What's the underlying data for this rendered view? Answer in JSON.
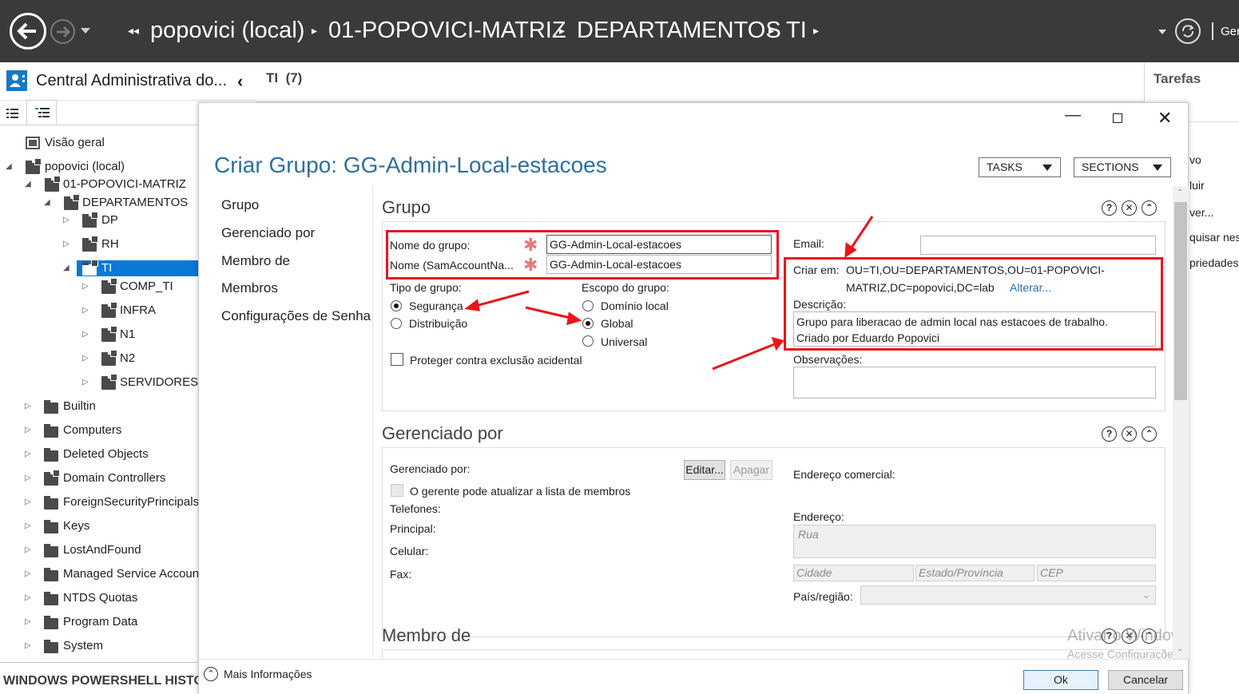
{
  "topbar": {
    "breadcrumb": [
      "popovici (local)",
      "01-POPOVICI-MATRIZ",
      "DEPARTAMENTOS",
      "TI"
    ],
    "right_text": "Ger"
  },
  "left_pane": {
    "title": "Central Administrativa do...",
    "tree": {
      "overview": "Visão geral",
      "domain": "popovici (local)",
      "matriz": "01-POPOVICI-MATRIZ",
      "departamentos": "DEPARTAMENTOS",
      "dp": "DP",
      "rh": "RH",
      "ti": "TI",
      "comp_ti": "COMP_TI",
      "infra": "INFRA",
      "n1": "N1",
      "n2": "N2",
      "servidores": "SERVIDORES",
      "builtin": "Builtin",
      "computers": "Computers",
      "deleted": "Deleted Objects",
      "dcs": "Domain Controllers",
      "fsp": "ForeignSecurityPrincipals",
      "keys": "Keys",
      "lostfound": "LostAndFound",
      "msa": "Managed Service Accounts",
      "ntds": "NTDS Quotas",
      "progdata": "Program Data",
      "system": "System"
    },
    "powershell": "WINDOWS POWERSHELL HISTORY"
  },
  "main_header": {
    "title": "TI",
    "count": "(7)"
  },
  "task_pane": {
    "title": "Tarefas",
    "items": [
      "vo",
      "luir",
      "ver...",
      "quisar nes",
      "priedades"
    ]
  },
  "dialog": {
    "title": "Criar Grupo: GG-Admin-Local-estacoes",
    "tasks_label": "TASKS",
    "sections_label": "SECTIONS",
    "nav": [
      "Grupo",
      "Gerenciado por",
      "Membro de",
      "Membros",
      "Configurações de Senha"
    ],
    "grupo": {
      "section_title": "Grupo",
      "name_label": "Nome do grupo:",
      "name_value": "GG-Admin-Local-estacoes",
      "sam_label": "Nome (SamAccountNa...",
      "sam_value": "GG-Admin-Local-estacoes",
      "type_label": "Tipo de grupo:",
      "type_options": [
        "Segurança",
        "Distribuição"
      ],
      "scope_label": "Escopo do grupo:",
      "scope_options": [
        "Domínio local",
        "Global",
        "Universal"
      ],
      "protect_label": "Proteger contra exclusão acidental",
      "email_label": "Email:",
      "email_value": "",
      "create_in_label": "Criar em:",
      "create_in_value_1": "OU=TI,OU=DEPARTAMENTOS,OU=01-POPOVICI-",
      "create_in_value_2": "MATRIZ,DC=popovici,DC=lab",
      "change_link": "Alterar...",
      "desc_label": "Descrição:",
      "desc_line1": "Grupo para liberacao de admin local nas estacoes de trabalho.",
      "desc_line2": "Criado por Eduardo Popovici",
      "notes_label": "Observações:"
    },
    "gerenciado": {
      "section_title": "Gerenciado por",
      "managed_label": "Gerenciado por:",
      "edit_btn": "Editar...",
      "clear_btn": "Apagar",
      "can_update_label": "O gerente pode atualizar a lista de membros",
      "phones_label": "Telefones:",
      "main_label": "Principal:",
      "cell_label": "Celular:",
      "fax_label": "Fax:",
      "office_label": "Endereço comercial:",
      "address_label": "Endereço:",
      "street_ph": "Rua",
      "city_ph": "Cidade",
      "state_ph": "Estado/Província",
      "zip_ph": "CEP",
      "country_label": "País/região:"
    },
    "membro_de": {
      "section_title": "Membro de"
    },
    "footer": {
      "more_info": "Mais Informações",
      "ok": "Ok",
      "cancel": "Cancelar"
    },
    "watermark": {
      "line1": "Ativar o Windows",
      "line2": "Acesse Configurações para ativar"
    }
  },
  "colors": {
    "annotation_red": "#e8141c",
    "title_blue": "#2e6f9e",
    "selection_blue": "#0a78d7"
  }
}
